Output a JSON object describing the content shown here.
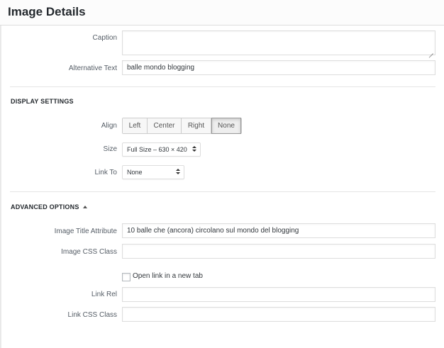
{
  "header": {
    "title": "Image Details"
  },
  "fields": {
    "caption": {
      "label": "Caption",
      "value": ""
    },
    "alt_text": {
      "label": "Alternative Text",
      "value": "balle mondo blogging"
    }
  },
  "display_settings": {
    "title": "DISPLAY SETTINGS",
    "align": {
      "label": "Align",
      "options": [
        "Left",
        "Center",
        "Right",
        "None"
      ],
      "selected": "None"
    },
    "size": {
      "label": "Size",
      "value": "Full Size – 630 × 420"
    },
    "link_to": {
      "label": "Link To",
      "value": "None"
    }
  },
  "advanced_options": {
    "title": "ADVANCED OPTIONS",
    "image_title_attribute": {
      "label": "Image Title Attribute",
      "value": "10 balle che (ancora) circolano sul mondo del blogging"
    },
    "image_css_class": {
      "label": "Image CSS Class",
      "value": ""
    },
    "open_new_tab": {
      "label": "Open link in a new tab",
      "checked": false
    },
    "link_rel": {
      "label": "Link Rel",
      "value": ""
    },
    "link_css_class": {
      "label": "Link CSS Class",
      "value": ""
    }
  }
}
